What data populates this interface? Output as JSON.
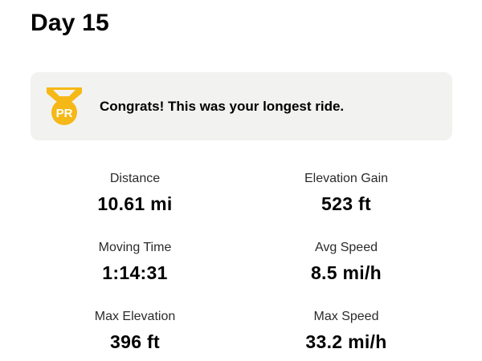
{
  "page": {
    "title": "Day 15"
  },
  "achievement": {
    "badge_text": "PR",
    "badge_icon": "pr-medal-icon",
    "badge_color": "#F5B816",
    "message": "Congrats! This was your longest ride."
  },
  "stats": [
    {
      "label": "Distance",
      "value": "10.61 mi"
    },
    {
      "label": "Elevation Gain",
      "value": "523 ft"
    },
    {
      "label": "Moving Time",
      "value": "1:14:31"
    },
    {
      "label": "Avg Speed",
      "value": "8.5 mi/h"
    },
    {
      "label": "Max Elevation",
      "value": "396 ft"
    },
    {
      "label": "Max Speed",
      "value": "33.2 mi/h"
    }
  ]
}
